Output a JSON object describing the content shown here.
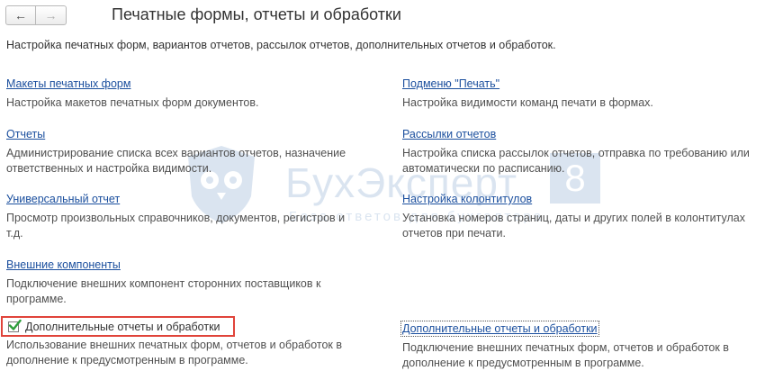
{
  "header": {
    "back_icon": "arrow-left-icon",
    "forward_icon": "arrow-right-icon",
    "title": "Печатные формы, отчеты и обработки"
  },
  "subtitle": "Настройка печатных форм, вариантов отчетов, рассылок отчетов, дополнительных отчетов и обработок.",
  "watermark": {
    "text": "БухЭксперт",
    "number": "8",
    "sub": "База ответов для бухгалтера"
  },
  "left": {
    "item0": {
      "link": "Макеты печатных форм",
      "desc": "Настройка макетов печатных форм документов."
    },
    "item1": {
      "link": "Отчеты",
      "desc": "Администрирование списка всех вариантов отчетов, назначение ответственных и настройка видимости."
    },
    "item2": {
      "link": "Универсальный отчет",
      "desc": "Просмотр произвольных справочников, документов, регистров и т.д."
    },
    "item3": {
      "link": "Внешние компоненты",
      "desc": "Подключение внешних компонент сторонних поставщиков к программе."
    },
    "option": {
      "checked": true,
      "label": "Дополнительные отчеты и обработки",
      "desc": "Использование внешних печатных форм, отчетов и обработок в дополнение к предусмотренным в программе."
    }
  },
  "right": {
    "item0": {
      "link": "Подменю \"Печать\"",
      "desc": "Настройка видимости команд печати в формах."
    },
    "item1": {
      "link": "Рассылки отчетов",
      "desc": "Настройка списка рассылок отчетов, отправка по требованию или автоматически по расписанию."
    },
    "item2": {
      "link": "Настройка колонтитулов",
      "desc": "Установка номеров страниц, даты и других полей в колонтитулах отчетов при печати."
    },
    "item3": {
      "link": "Дополнительные отчеты и обработки",
      "desc": "Подключение внешних печатных форм, отчетов и обработок в дополнение к предусмотренным в программе."
    }
  },
  "colors": {
    "link": "#1b4f9e",
    "highlight": "#e0443a",
    "check": "#2e9e3b"
  }
}
